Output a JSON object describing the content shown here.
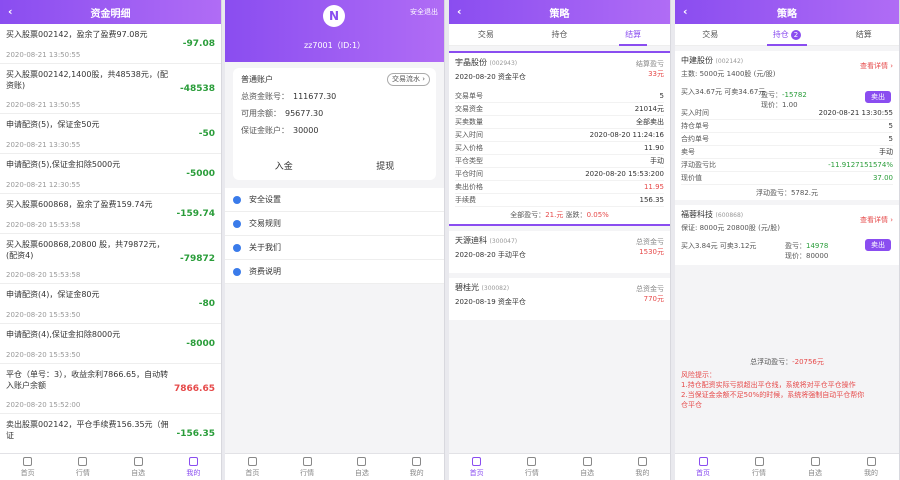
{
  "panel1": {
    "title": "资金明细",
    "rows": [
      {
        "desc": "买入股票002142，盈余了盈费97.08元",
        "time": "2020-08-21 13:50:55",
        "amount": "-97.08",
        "color": "green",
        "tall": false
      },
      {
        "desc": "买入股票002142,1400股，共48538元，(配资账)",
        "time": "2020-08-21 13:50:55",
        "amount": "-48538",
        "color": "green",
        "tall": true
      },
      {
        "desc": "申请配资(5)，保证金50元",
        "time": "2020-08-21 13:30:55",
        "amount": "-50",
        "color": "green",
        "tall": false
      },
      {
        "desc": "申请配资(5),保证金扣除5000元",
        "time": "2020-08-21 12:30:55",
        "amount": "-5000",
        "color": "green",
        "tall": false
      },
      {
        "desc": "买入股票600868，盈余了盈费159.74元",
        "time": "2020-08-20 15:53:58",
        "amount": "-159.74",
        "color": "green",
        "tall": false
      },
      {
        "desc": "买入股票600868,20800 股，共79872元，(配资4)",
        "time": "2020-08-20 15:53:58",
        "amount": "-79872",
        "color": "green",
        "tall": true
      },
      {
        "desc": "申请配资(4)，保证金80元",
        "time": "2020-08-20 15:53:50",
        "amount": "-80",
        "color": "green",
        "tall": false
      },
      {
        "desc": "申请配资(4),保证金扣除8000元",
        "time": "2020-08-20 15:53:50",
        "amount": "-8000",
        "color": "green",
        "tall": false
      },
      {
        "desc": "平仓（单号：3），收益余利7866.65，自动转入账户余额",
        "time": "2020-08-20 15:52:00",
        "amount": "7866.65",
        "color": "red",
        "tall": true
      },
      {
        "desc": "卖出股票002142，平仓手续费156.35元（佣证",
        "time": "",
        "amount": "-156.35",
        "color": "green",
        "tall": false
      }
    ]
  },
  "panel2": {
    "exit_label": "安全退出",
    "logo_char": "N",
    "username": "zz7001（ID:1）",
    "account_title": "普通账户",
    "options_label": "交易流水 ›",
    "total_label": "总资金账号：",
    "total_value": "111677.30",
    "avail_label": "可用余额：",
    "avail_value": "95677.30",
    "margin_label": "保证金账户：",
    "margin_value": "30000",
    "deposit_label": "入金",
    "withdraw_label": "提现",
    "menu": [
      "安全设置",
      "交易规则",
      "关于我们",
      "资费说明"
    ]
  },
  "panel3": {
    "title": "策略",
    "tabs": [
      "交易",
      "持仓",
      "结算"
    ],
    "active_tab": 2,
    "cards": [
      {
        "name": "宇晶股份",
        "code": "(002943)",
        "date": "2020-08-20 资金平仓",
        "right_label": "结算盈亏",
        "right_value": "33元",
        "details": [
          [
            "交易单号",
            "5"
          ],
          [
            "交易资金",
            "21014元"
          ],
          [
            "买卖数量",
            "全部卖出"
          ],
          [
            "买入时间",
            "2020-08-20 11:24:16"
          ],
          [
            "买入价格",
            "11.90"
          ],
          [
            "平仓类型",
            "手动"
          ],
          [
            "平仓时间",
            "2020-08-20 15:53:200"
          ],
          [
            "卖出价格",
            "11.95"
          ],
          [
            "手续费",
            "156.35"
          ]
        ],
        "foot_profit_label": "全部盈亏：",
        "foot_profit": "21.元",
        "foot_rate_label": "  涨跌：",
        "foot_rate": "0.05%"
      },
      {
        "name": "天源迪科",
        "code": "(300047)",
        "date": "2020-08-20 手动平仓",
        "right_label": "总资金亏",
        "right_value": "1530元"
      },
      {
        "name": "碧桂光",
        "code": "(300082)",
        "date": "2020-08-19 资金平仓",
        "right_label": "总资金亏",
        "right_value": "770元"
      }
    ]
  },
  "panel4": {
    "title": "策略",
    "tabs": [
      "交易",
      "持仓",
      "结算"
    ],
    "active_tab": 1,
    "badge": "2",
    "card1": {
      "name": "中建股份",
      "code": "(002142)",
      "line1": "主数: 5000元 1400股 (元/股)",
      "status": "查看详情 ›",
      "profit_label": "盈亏：",
      "profit": "-15782",
      "sub1": "买入34.67元 可卖34.67元",
      "sub2": "现价：1.00",
      "sell": "卖出",
      "details": [
        [
          "买入时间",
          "2020-08-21 13:30:55"
        ],
        [
          "持仓单号",
          "5"
        ],
        [
          "合约单号",
          "5"
        ],
        [
          "卖号",
          "手动"
        ],
        [
          "浮动盈亏比",
          "-11.9127151574%"
        ],
        [
          "现价值",
          "37.00"
        ]
      ],
      "float_label": "浮动盈亏：",
      "float_value": "5782.元"
    },
    "card2": {
      "name": "福蓉科技",
      "code": "(600868)",
      "line1": "保证: 8000元 20800股 (元/股)",
      "status": "查看详情 ›",
      "profit_label": "盈亏：",
      "profit": "14978",
      "sub1": "买入3.84元 可卖3.12元",
      "sub2": "现价：80000",
      "sell": "卖出"
    },
    "total_label": "总浮动盈亏：",
    "total_value": "-20756元",
    "warn_title": "风险提示：",
    "warn_lines": [
      "1.持仓配资实际亏损超出平仓线，系统将对平仓平仓操作",
      "2.当保证金余额不足50%的时候，系统将强制自动平仓帮你",
      "仓平仓"
    ]
  },
  "bottom_nav": [
    "首页",
    "行情",
    "自选",
    "我的"
  ]
}
